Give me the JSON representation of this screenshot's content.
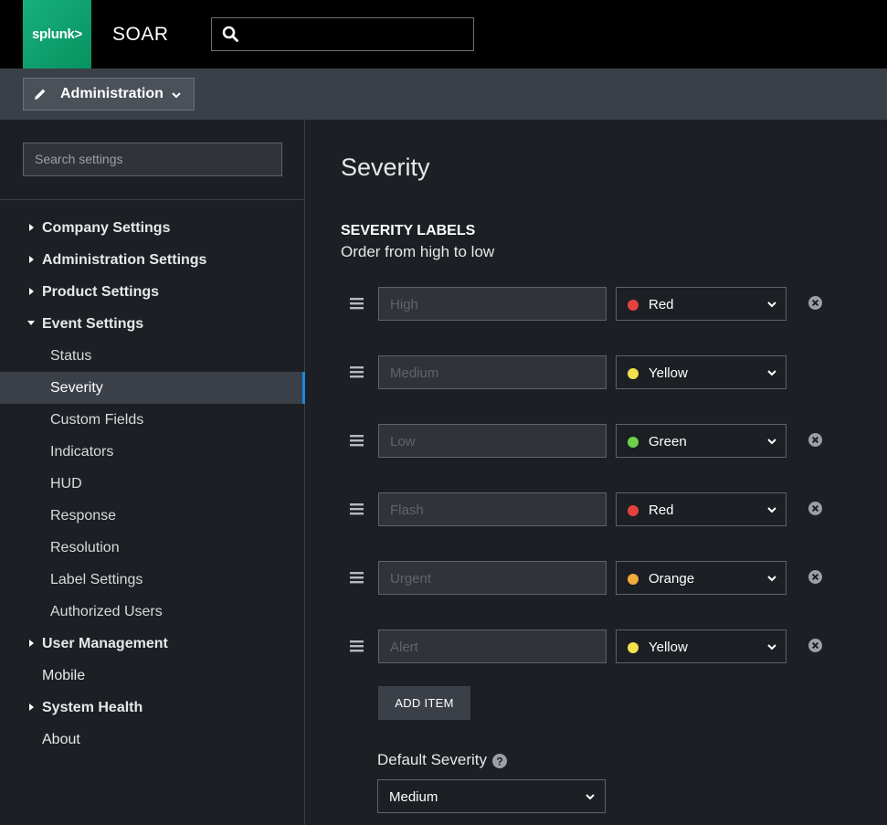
{
  "brand": {
    "logo_text": "splunk>",
    "app_title": "SOAR"
  },
  "top_search": {
    "placeholder": ""
  },
  "context_menu": {
    "label": "Administration"
  },
  "sidebar": {
    "search_placeholder": "Search settings",
    "items": [
      {
        "label": "Company Settings",
        "kind": "top",
        "expanded": false
      },
      {
        "label": "Administration Settings",
        "kind": "top",
        "expanded": false
      },
      {
        "label": "Product Settings",
        "kind": "top",
        "expanded": false
      },
      {
        "label": "Event Settings",
        "kind": "top",
        "expanded": true
      },
      {
        "label": "Status",
        "kind": "sub"
      },
      {
        "label": "Severity",
        "kind": "sub",
        "active": true
      },
      {
        "label": "Custom Fields",
        "kind": "sub"
      },
      {
        "label": "Indicators",
        "kind": "sub"
      },
      {
        "label": "HUD",
        "kind": "sub"
      },
      {
        "label": "Response",
        "kind": "sub"
      },
      {
        "label": "Resolution",
        "kind": "sub"
      },
      {
        "label": "Label Settings",
        "kind": "sub"
      },
      {
        "label": "Authorized Users",
        "kind": "sub"
      },
      {
        "label": "User Management",
        "kind": "top",
        "expanded": false
      },
      {
        "label": "Mobile",
        "kind": "plain"
      },
      {
        "label": "System Health",
        "kind": "top",
        "expanded": false
      },
      {
        "label": "About",
        "kind": "plain"
      }
    ]
  },
  "main": {
    "title": "Severity",
    "section_title": "SEVERITY LABELS",
    "section_subtitle": "Order from high to low",
    "rows": [
      {
        "placeholder": "High",
        "color": "Red",
        "dot": "#e5423f",
        "removable": true
      },
      {
        "placeholder": "Medium",
        "color": "Yellow",
        "dot": "#f4e04d",
        "removable": false
      },
      {
        "placeholder": "Low",
        "color": "Green",
        "dot": "#6fd04a",
        "removable": true
      },
      {
        "placeholder": "Flash",
        "color": "Red",
        "dot": "#e5423f",
        "removable": true
      },
      {
        "placeholder": "Urgent",
        "color": "Orange",
        "dot": "#f2ac3c",
        "removable": true
      },
      {
        "placeholder": "Alert",
        "color": "Yellow",
        "dot": "#f4e04d",
        "removable": true
      }
    ],
    "add_item_label": "ADD ITEM",
    "default_severity_label": "Default Severity",
    "default_severity_value": "Medium"
  },
  "colors": {
    "accent": "#1a8ad9",
    "brand": "#0da474"
  }
}
